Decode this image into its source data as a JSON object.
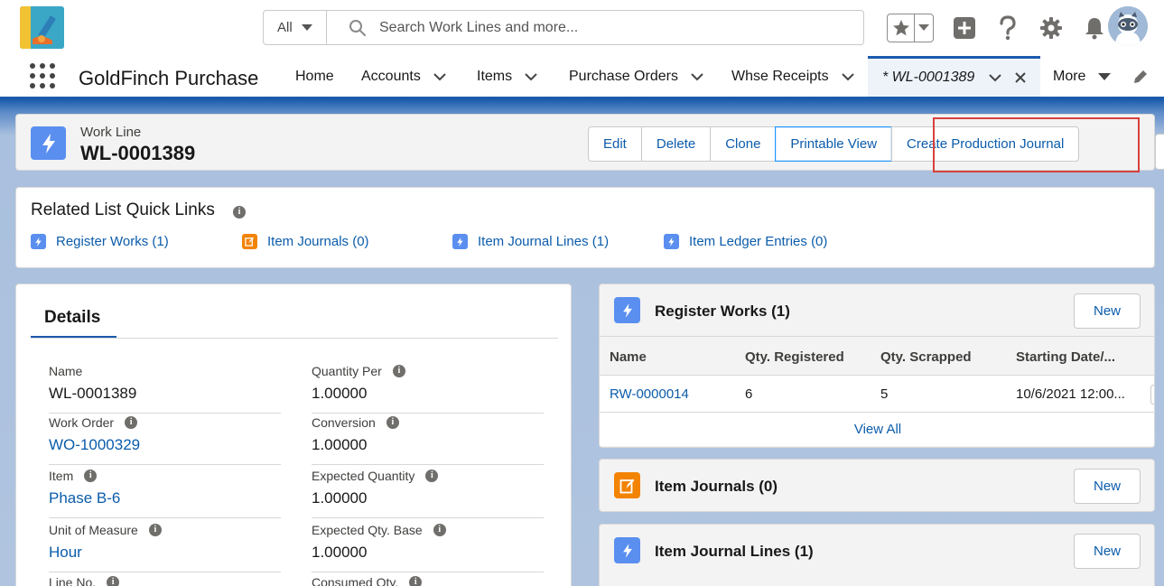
{
  "search": {
    "scope": "All",
    "placeholder": "Search Work Lines and more..."
  },
  "header_icons": [
    "favorites-star-icon",
    "global-add-icon",
    "help-icon",
    "setup-gear-icon",
    "notifications-bell-icon",
    "user-avatar"
  ],
  "nav": {
    "app_name": "GoldFinch Purchase",
    "items": [
      {
        "label": "Home",
        "has_menu": false
      },
      {
        "label": "Accounts",
        "has_menu": true
      },
      {
        "label": "Items",
        "has_menu": true
      },
      {
        "label": "Purchase Orders",
        "has_menu": true
      },
      {
        "label": "Whse Receipts",
        "has_menu": true
      }
    ],
    "active_tab": "* WL-0001389",
    "more": "More"
  },
  "record": {
    "type": "Work Line",
    "name": "WL-0001389",
    "actions": {
      "edit": "Edit",
      "delete": "Delete",
      "clone": "Clone",
      "printable_view": "Printable View",
      "create_production_journal": "Create Production Journal"
    }
  },
  "quick_links": {
    "title": "Related List Quick Links",
    "links": [
      {
        "label": "Register Works (1)",
        "icon": "lightning-icon",
        "color": "#5a8ff0"
      },
      {
        "label": "Item Journals (0)",
        "icon": "journal-edit-icon",
        "color": "#f38303"
      },
      {
        "label": "Item Journal Lines (1)",
        "icon": "lightning-icon",
        "color": "#5a8ff0"
      },
      {
        "label": "Item Ledger Entries (0)",
        "icon": "lightning-icon",
        "color": "#5a8ff0"
      }
    ]
  },
  "details": {
    "tab_label": "Details",
    "left_fields": [
      {
        "label": "Name",
        "value": "WL-0001389",
        "info": false,
        "link": false
      },
      {
        "label": "Work Order",
        "value": "WO-1000329",
        "info": true,
        "link": true
      },
      {
        "label": "Item",
        "value": "Phase B-6",
        "info": true,
        "link": true
      },
      {
        "label": "Unit of Measure",
        "value": "Hour",
        "info": true,
        "link": true
      },
      {
        "label": "Line No.",
        "value": "",
        "info": true,
        "link": false
      }
    ],
    "right_fields": [
      {
        "label": "Quantity Per",
        "value": "1.00000",
        "info": true
      },
      {
        "label": "Conversion",
        "value": "1.00000",
        "info": true
      },
      {
        "label": "Expected Quantity",
        "value": "1.00000",
        "info": true
      },
      {
        "label": "Expected Qty. Base",
        "value": "1.00000",
        "info": true
      },
      {
        "label": "Consumed Qty.",
        "value": "",
        "info": true
      }
    ]
  },
  "related": {
    "register_works": {
      "title": "Register Works (1)",
      "new_label": "New",
      "columns": [
        "Name",
        "Qty. Registered",
        "Qty. Scrapped",
        "Starting Date/..."
      ],
      "rows": [
        [
          "RW-0000014",
          "6",
          "5",
          "10/6/2021 12:00..."
        ]
      ],
      "view_all": "View All"
    },
    "item_journals": {
      "title": "Item Journals (0)",
      "new_label": "New"
    },
    "item_journal_lines": {
      "title": "Item Journal Lines (1)",
      "new_label": "New"
    }
  },
  "colors": {
    "brand_blue": "#1b5bab",
    "link_blue": "#0b5cab",
    "object_icon_blue": "#5a8ff0",
    "object_icon_orange": "#f38303",
    "highlight_red": "#d9403a"
  }
}
